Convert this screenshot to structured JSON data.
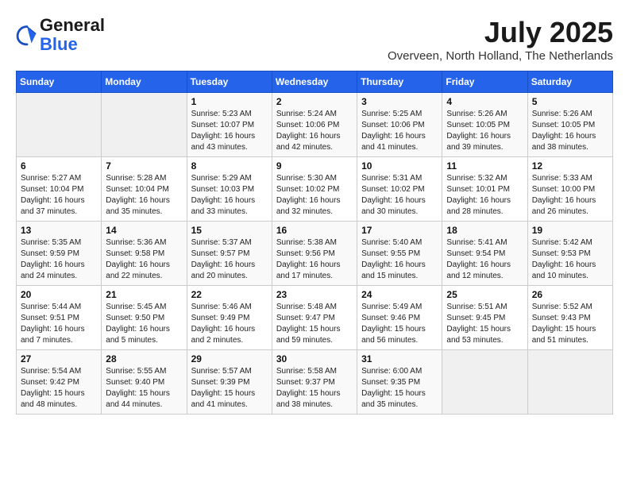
{
  "header": {
    "logo_line1": "General",
    "logo_line2": "Blue",
    "month_title": "July 2025",
    "location": "Overveen, North Holland, The Netherlands"
  },
  "days_of_week": [
    "Sunday",
    "Monday",
    "Tuesday",
    "Wednesday",
    "Thursday",
    "Friday",
    "Saturday"
  ],
  "weeks": [
    [
      {
        "day": "",
        "info": ""
      },
      {
        "day": "",
        "info": ""
      },
      {
        "day": "1",
        "info": "Sunrise: 5:23 AM\nSunset: 10:07 PM\nDaylight: 16 hours\nand 43 minutes."
      },
      {
        "day": "2",
        "info": "Sunrise: 5:24 AM\nSunset: 10:06 PM\nDaylight: 16 hours\nand 42 minutes."
      },
      {
        "day": "3",
        "info": "Sunrise: 5:25 AM\nSunset: 10:06 PM\nDaylight: 16 hours\nand 41 minutes."
      },
      {
        "day": "4",
        "info": "Sunrise: 5:26 AM\nSunset: 10:05 PM\nDaylight: 16 hours\nand 39 minutes."
      },
      {
        "day": "5",
        "info": "Sunrise: 5:26 AM\nSunset: 10:05 PM\nDaylight: 16 hours\nand 38 minutes."
      }
    ],
    [
      {
        "day": "6",
        "info": "Sunrise: 5:27 AM\nSunset: 10:04 PM\nDaylight: 16 hours\nand 37 minutes."
      },
      {
        "day": "7",
        "info": "Sunrise: 5:28 AM\nSunset: 10:04 PM\nDaylight: 16 hours\nand 35 minutes."
      },
      {
        "day": "8",
        "info": "Sunrise: 5:29 AM\nSunset: 10:03 PM\nDaylight: 16 hours\nand 33 minutes."
      },
      {
        "day": "9",
        "info": "Sunrise: 5:30 AM\nSunset: 10:02 PM\nDaylight: 16 hours\nand 32 minutes."
      },
      {
        "day": "10",
        "info": "Sunrise: 5:31 AM\nSunset: 10:02 PM\nDaylight: 16 hours\nand 30 minutes."
      },
      {
        "day": "11",
        "info": "Sunrise: 5:32 AM\nSunset: 10:01 PM\nDaylight: 16 hours\nand 28 minutes."
      },
      {
        "day": "12",
        "info": "Sunrise: 5:33 AM\nSunset: 10:00 PM\nDaylight: 16 hours\nand 26 minutes."
      }
    ],
    [
      {
        "day": "13",
        "info": "Sunrise: 5:35 AM\nSunset: 9:59 PM\nDaylight: 16 hours\nand 24 minutes."
      },
      {
        "day": "14",
        "info": "Sunrise: 5:36 AM\nSunset: 9:58 PM\nDaylight: 16 hours\nand 22 minutes."
      },
      {
        "day": "15",
        "info": "Sunrise: 5:37 AM\nSunset: 9:57 PM\nDaylight: 16 hours\nand 20 minutes."
      },
      {
        "day": "16",
        "info": "Sunrise: 5:38 AM\nSunset: 9:56 PM\nDaylight: 16 hours\nand 17 minutes."
      },
      {
        "day": "17",
        "info": "Sunrise: 5:40 AM\nSunset: 9:55 PM\nDaylight: 16 hours\nand 15 minutes."
      },
      {
        "day": "18",
        "info": "Sunrise: 5:41 AM\nSunset: 9:54 PM\nDaylight: 16 hours\nand 12 minutes."
      },
      {
        "day": "19",
        "info": "Sunrise: 5:42 AM\nSunset: 9:53 PM\nDaylight: 16 hours\nand 10 minutes."
      }
    ],
    [
      {
        "day": "20",
        "info": "Sunrise: 5:44 AM\nSunset: 9:51 PM\nDaylight: 16 hours\nand 7 minutes."
      },
      {
        "day": "21",
        "info": "Sunrise: 5:45 AM\nSunset: 9:50 PM\nDaylight: 16 hours\nand 5 minutes."
      },
      {
        "day": "22",
        "info": "Sunrise: 5:46 AM\nSunset: 9:49 PM\nDaylight: 16 hours\nand 2 minutes."
      },
      {
        "day": "23",
        "info": "Sunrise: 5:48 AM\nSunset: 9:47 PM\nDaylight: 15 hours\nand 59 minutes."
      },
      {
        "day": "24",
        "info": "Sunrise: 5:49 AM\nSunset: 9:46 PM\nDaylight: 15 hours\nand 56 minutes."
      },
      {
        "day": "25",
        "info": "Sunrise: 5:51 AM\nSunset: 9:45 PM\nDaylight: 15 hours\nand 53 minutes."
      },
      {
        "day": "26",
        "info": "Sunrise: 5:52 AM\nSunset: 9:43 PM\nDaylight: 15 hours\nand 51 minutes."
      }
    ],
    [
      {
        "day": "27",
        "info": "Sunrise: 5:54 AM\nSunset: 9:42 PM\nDaylight: 15 hours\nand 48 minutes."
      },
      {
        "day": "28",
        "info": "Sunrise: 5:55 AM\nSunset: 9:40 PM\nDaylight: 15 hours\nand 44 minutes."
      },
      {
        "day": "29",
        "info": "Sunrise: 5:57 AM\nSunset: 9:39 PM\nDaylight: 15 hours\nand 41 minutes."
      },
      {
        "day": "30",
        "info": "Sunrise: 5:58 AM\nSunset: 9:37 PM\nDaylight: 15 hours\nand 38 minutes."
      },
      {
        "day": "31",
        "info": "Sunrise: 6:00 AM\nSunset: 9:35 PM\nDaylight: 15 hours\nand 35 minutes."
      },
      {
        "day": "",
        "info": ""
      },
      {
        "day": "",
        "info": ""
      }
    ]
  ]
}
